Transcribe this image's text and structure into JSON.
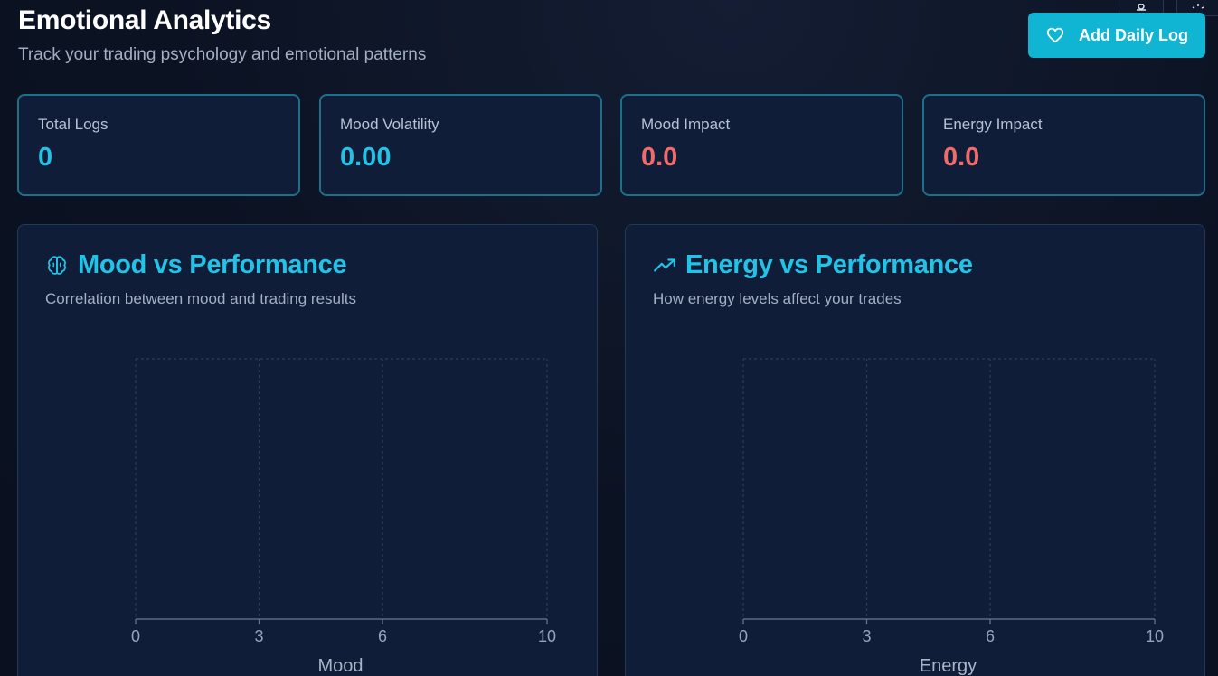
{
  "header": {
    "title": "Emotional Analytics",
    "subtitle": "Track your trading psychology and emotional patterns"
  },
  "top_icons": [
    "settings-icon",
    "sun-icon"
  ],
  "add_button": {
    "label": "Add Daily Log",
    "icon": "heart-icon"
  },
  "colors": {
    "accent": "#10b5d3",
    "positive": "#22c3e6",
    "negative": "#f26b6b",
    "card_border": "#1d6f8a"
  },
  "stats": [
    {
      "label": "Total Logs",
      "value": "0",
      "tone": "positive"
    },
    {
      "label": "Mood Volatility",
      "value": "0.00",
      "tone": "positive"
    },
    {
      "label": "Mood Impact",
      "value": "0.0",
      "tone": "negative"
    },
    {
      "label": "Energy Impact",
      "value": "0.0",
      "tone": "negative"
    }
  ],
  "panels": [
    {
      "title": "Mood vs Performance",
      "subtitle": "Correlation between mood and trading results",
      "icon": "brain-icon"
    },
    {
      "title": "Energy vs Performance",
      "subtitle": "How energy levels affect your trades",
      "icon": "trending-up-icon"
    }
  ],
  "chart_data": [
    {
      "type": "scatter",
      "title": "Mood vs Performance",
      "xlabel": "Mood",
      "ylabel": "",
      "x_ticks": [
        0,
        3,
        6,
        10
      ],
      "xlim": [
        0,
        10
      ],
      "series": [],
      "grid": true
    },
    {
      "type": "scatter",
      "title": "Energy vs Performance",
      "xlabel": "Energy",
      "ylabel": "",
      "x_ticks": [
        0,
        3,
        6,
        10
      ],
      "xlim": [
        0,
        10
      ],
      "series": [],
      "grid": true
    }
  ]
}
